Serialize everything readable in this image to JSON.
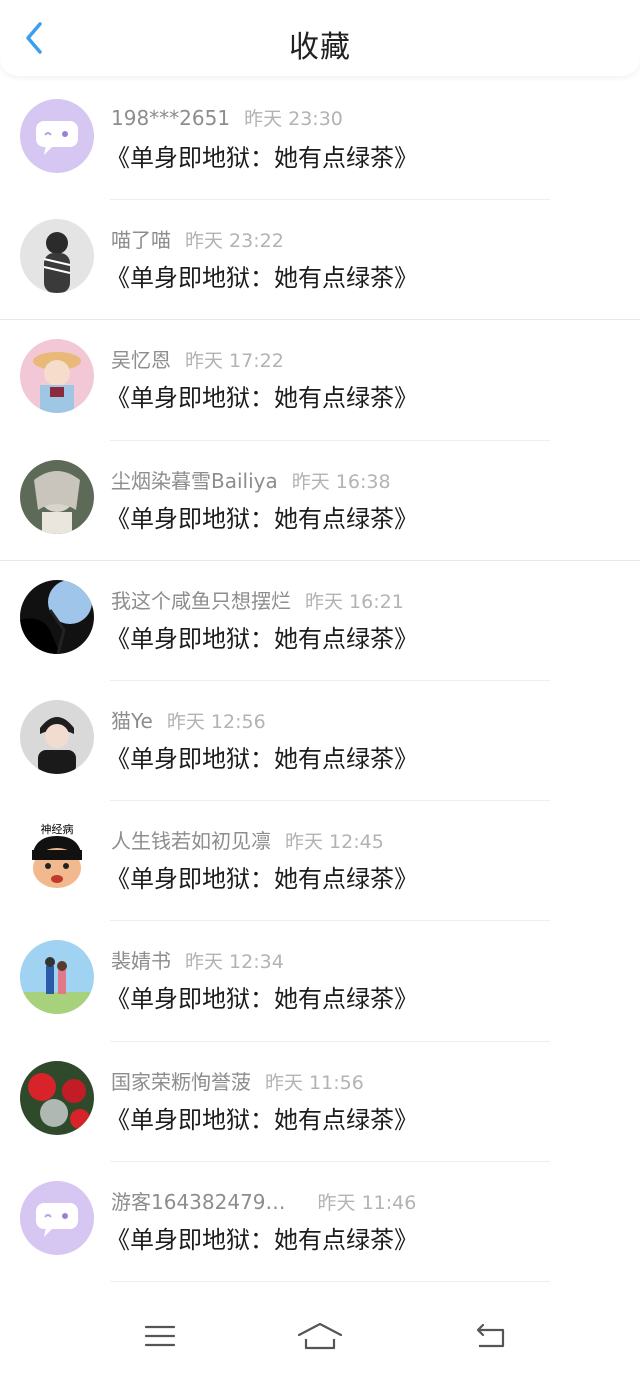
{
  "header": {
    "title": "收藏",
    "back_icon": "chevron-left-icon",
    "accent": "#3a9ff0"
  },
  "items": [
    {
      "user": "198***2651",
      "time": "昨天 23:30",
      "work": "《单身即地狱：她有点绿茶》"
    },
    {
      "user": "喵了喵",
      "time": "昨天 23:22",
      "work": "《单身即地狱：她有点绿茶》"
    },
    {
      "user": "吴忆恩",
      "time": "昨天 17:22",
      "work": "《单身即地狱：她有点绿茶》"
    },
    {
      "user": "尘烟染暮雪Bailiya",
      "time": "昨天 16:38",
      "work": "《单身即地狱：她有点绿茶》"
    },
    {
      "user": "我这个咸鱼只想摆烂",
      "time": "昨天 16:21",
      "work": "《单身即地狱：她有点绿茶》"
    },
    {
      "user": "猫Ye",
      "time": "昨天 12:56",
      "work": "《单身即地狱：她有点绿茶》"
    },
    {
      "user": "人生钱若如初见凛",
      "time": "昨天 12:45",
      "work": "《单身即地狱：她有点绿茶》"
    },
    {
      "user": "裴婧书",
      "time": "昨天 12:34",
      "work": "《单身即地狱：她有点绿茶》"
    },
    {
      "user": "国家荣粝恂誉菠",
      "time": "昨天 11:56",
      "work": "《单身即地狱：她有点绿茶》"
    },
    {
      "user": "游客164382479…",
      "time": "昨天 11:46",
      "work": "《单身即地狱：她有点绿茶》"
    }
  ],
  "avatar_badge_text": "神经病",
  "navbar": {
    "menu_icon": "menu-icon",
    "home_icon": "home-icon",
    "back_icon": "return-icon"
  }
}
